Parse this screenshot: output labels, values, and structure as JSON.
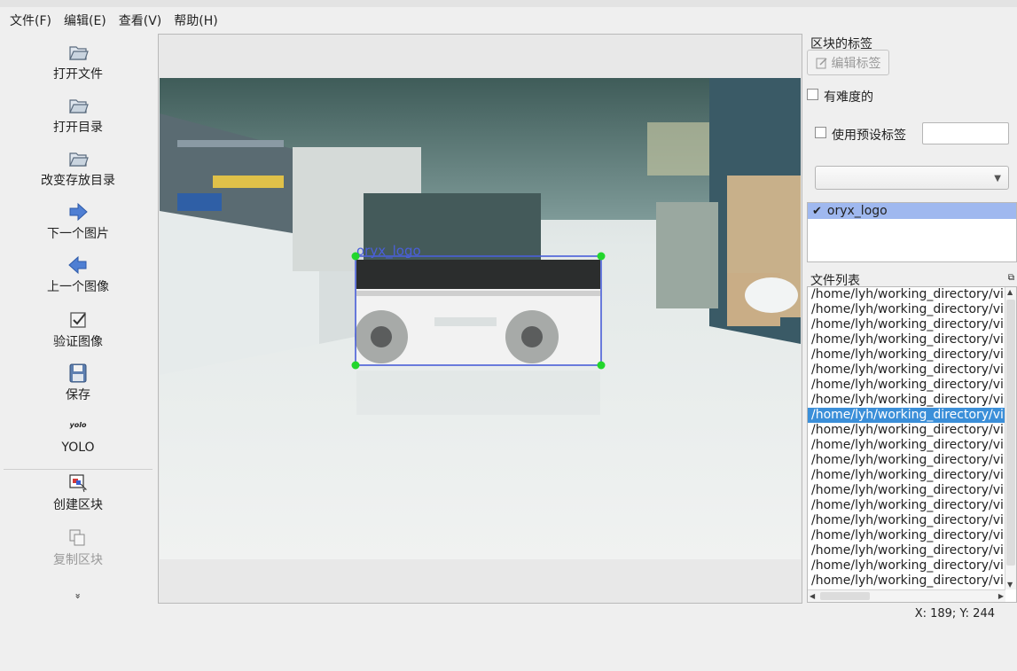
{
  "menu": [
    "文件(F)",
    "编辑(E)",
    "查看(V)",
    "帮助(H)"
  ],
  "toolbar": {
    "open_file": "打开文件",
    "open_dir": "打开目录",
    "change_save_dir": "改变存放目录",
    "next_image": "下一个图片",
    "prev_image": "上一个图像",
    "verify_image": "验证图像",
    "save": "保存",
    "yolo_icon_text": "yolo",
    "yolo": "YOLO",
    "create_box": "创建区块",
    "copy_box": "复制区块",
    "more": "»"
  },
  "canvas": {
    "box_label": "oryx_logo",
    "box_color": "#4a5fd9",
    "handle_color": "#22d62c"
  },
  "right_panel": {
    "box_labels_title": "区块的标签",
    "edit_label_btn": "编辑标签",
    "difficult": "有难度的",
    "use_default_label": "使用预设标签",
    "labels": [
      {
        "name": "oryx_logo",
        "checked": true
      }
    ],
    "file_list_title": "文件列表",
    "files": [
      "/home/lyh/working_directory/vi",
      "/home/lyh/working_directory/vi",
      "/home/lyh/working_directory/vi",
      "/home/lyh/working_directory/vi",
      "/home/lyh/working_directory/vi",
      "/home/lyh/working_directory/vi",
      "/home/lyh/working_directory/vi",
      "/home/lyh/working_directory/vi",
      "/home/lyh/working_directory/vi",
      "/home/lyh/working_directory/vi",
      "/home/lyh/working_directory/vi",
      "/home/lyh/working_directory/vi",
      "/home/lyh/working_directory/vi",
      "/home/lyh/working_directory/vi",
      "/home/lyh/working_directory/vi",
      "/home/lyh/working_directory/vi",
      "/home/lyh/working_directory/vi",
      "/home/lyh/working_directory/vi",
      "/home/lyh/working_directory/vi",
      "/home/lyh/working_directory/vi"
    ],
    "selected_file_index": 8
  },
  "status": {
    "coords": "X: 189; Y: 244"
  }
}
